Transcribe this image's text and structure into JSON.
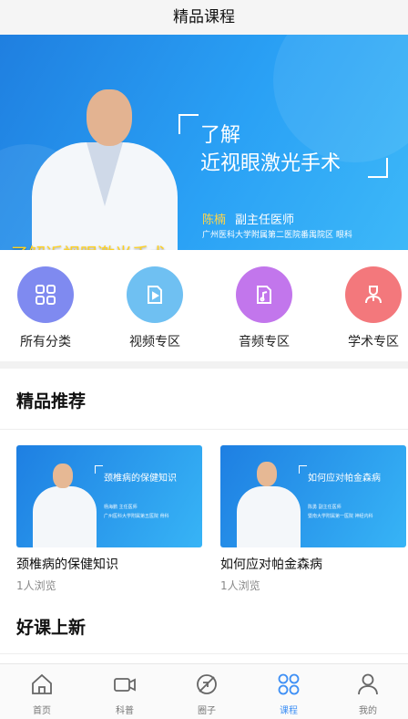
{
  "header": {
    "title": "精品课程"
  },
  "banner": {
    "headline_line1": "了解",
    "headline_line2": "近视眼激光手术",
    "doctor_name": "陈楠",
    "doctor_title": "副主任医师",
    "hospital": "广州医科大学附属第二医院番禺院区  眼科",
    "caption": "了解近视眼激光手术"
  },
  "categories": [
    {
      "label": "所有分类",
      "icon": "grid-icon",
      "color": "#7f8af0"
    },
    {
      "label": "视频专区",
      "icon": "video-icon",
      "color": "#6fc0f2"
    },
    {
      "label": "音频专区",
      "icon": "audio-icon",
      "color": "#c276ec"
    },
    {
      "label": "学术专区",
      "icon": "doctor-icon",
      "color": "#f3787c"
    }
  ],
  "sections": {
    "recommended": "精品推荐",
    "new_courses": "好课上新"
  },
  "cards": [
    {
      "image_title": "颈椎病的保健知识",
      "image_doctor": "杨海鹏  主任医师",
      "image_hospital": "广州医科大学附属第五医院  骨科",
      "title": "颈椎病的保健知识",
      "views": "1人浏览"
    },
    {
      "image_title": "如何应对帕金森病",
      "image_doctor": "陈勇  副主任医师",
      "image_hospital": "暨南大学附属第一医院  神经内科",
      "title": "如何应对帕金森病",
      "views": "1人浏览"
    }
  ],
  "bottom_nav": [
    {
      "label": "首页",
      "icon": "home-icon",
      "active": false
    },
    {
      "label": "科普",
      "icon": "camera-icon",
      "active": false
    },
    {
      "label": "圈子",
      "icon": "circle-icon",
      "active": false
    },
    {
      "label": "课程",
      "icon": "course-icon",
      "active": true
    },
    {
      "label": "我的",
      "icon": "user-icon",
      "active": false
    }
  ],
  "colors": {
    "accent": "#3d8ff5",
    "caption_yellow": "#ffd21f"
  }
}
